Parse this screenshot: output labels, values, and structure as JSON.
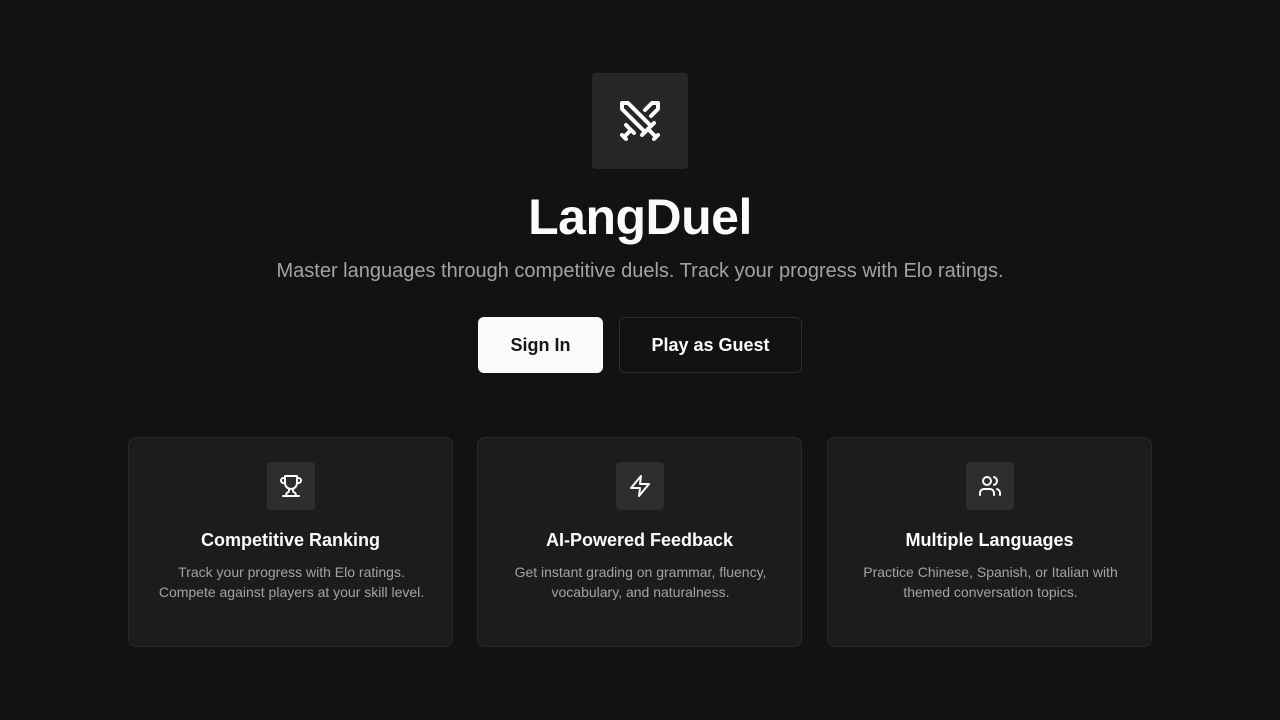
{
  "hero": {
    "logo_icon": "crossed-swords-icon",
    "title": "LangDuel",
    "subtitle": "Master languages through competitive duels. Track your progress with Elo ratings."
  },
  "actions": {
    "sign_in_label": "Sign In",
    "guest_label": "Play as Guest"
  },
  "features": [
    {
      "icon": "trophy-icon",
      "title": "Competitive Ranking",
      "description": "Track your progress with Elo ratings. Compete against players at your skill level."
    },
    {
      "icon": "lightning-icon",
      "title": "AI-Powered Feedback",
      "description": "Get instant grading on grammar, fluency, vocabulary, and naturalness."
    },
    {
      "icon": "users-icon",
      "title": "Multiple Languages",
      "description": "Practice Chinese, Spanish, or Italian with themed conversation topics."
    }
  ],
  "colors": {
    "background": "#121212",
    "card": "#1c1c1c",
    "primary_button": "#fafafa",
    "muted_text": "#a3a3a3"
  }
}
